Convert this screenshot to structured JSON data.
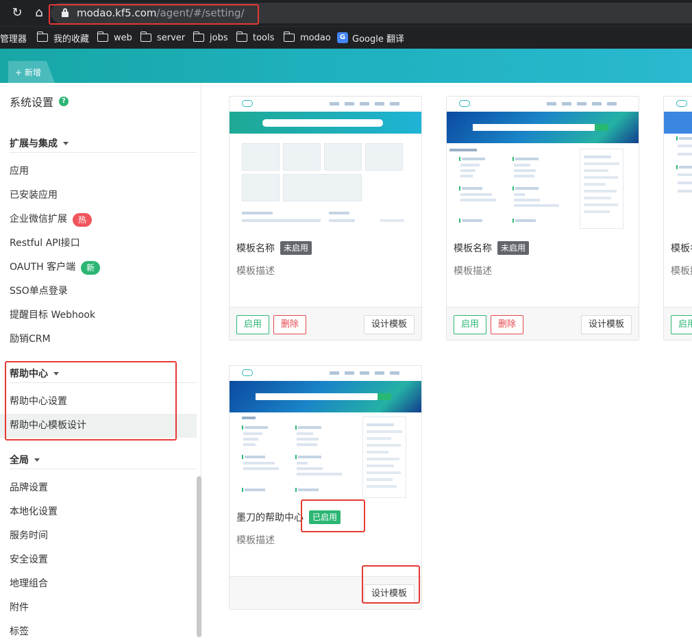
{
  "browser": {
    "url_host": "modao.kf5.com",
    "url_path": "/agent/#/setting/",
    "bookmarks": [
      {
        "label": "管理器",
        "icon": "none"
      },
      {
        "label": "我的收藏",
        "icon": "folder-icon"
      },
      {
        "label": "web",
        "icon": "folder-icon"
      },
      {
        "label": "server",
        "icon": "folder-icon"
      },
      {
        "label": "jobs",
        "icon": "folder-icon"
      },
      {
        "label": "tools",
        "icon": "folder-icon"
      },
      {
        "label": "modao",
        "icon": "folder-icon"
      },
      {
        "label": "Google 翻译",
        "icon": "google-translate-icon"
      }
    ]
  },
  "header": {
    "new_tab_label": "+ 新增"
  },
  "sidebar": {
    "title": "系统设置",
    "help_glyph": "?",
    "groups": [
      {
        "label": "扩展与集成",
        "items": [
          {
            "label": "应用"
          },
          {
            "label": "已安装应用"
          },
          {
            "label": "企业微信扩展",
            "badge": "热"
          },
          {
            "label": "Restful API接口"
          },
          {
            "label": "OAUTH 客户端",
            "badge": "新"
          },
          {
            "label": "SSO单点登录"
          },
          {
            "label": "提醒目标 Webhook"
          },
          {
            "label": "励销CRM"
          }
        ]
      },
      {
        "label": "帮助中心",
        "items": [
          {
            "label": "帮助中心设置"
          },
          {
            "label": "帮助中心模板设计",
            "active": true
          }
        ]
      },
      {
        "label": "全局",
        "items": [
          {
            "label": "品牌设置"
          },
          {
            "label": "本地化设置"
          },
          {
            "label": "服务时间"
          },
          {
            "label": "安全设置"
          },
          {
            "label": "地理组合"
          },
          {
            "label": "附件"
          },
          {
            "label": "标签"
          }
        ]
      }
    ]
  },
  "cards": [
    {
      "title": "模板名称",
      "status": "未启用",
      "status_type": "off",
      "desc": "模板描述",
      "buttons": [
        "启用",
        "删除",
        "设计模板"
      ]
    },
    {
      "title": "模板名称",
      "status": "未启用",
      "status_type": "off",
      "desc": "模板描述",
      "buttons": [
        "启用",
        "删除",
        "设计模板"
      ]
    },
    {
      "title": "模板名称",
      "desc": "模板描述",
      "buttons": [
        "启用"
      ]
    },
    {
      "title": "墨刀的帮助中心",
      "status": "已启用",
      "status_type": "on",
      "desc": "模板描述",
      "buttons": [
        "设计模板"
      ]
    }
  ],
  "colors": {
    "accent_green": "#2bb673",
    "danger_red": "#e5484d",
    "header_teal": "#1fb1bf",
    "annotation_red": "#e53935"
  }
}
